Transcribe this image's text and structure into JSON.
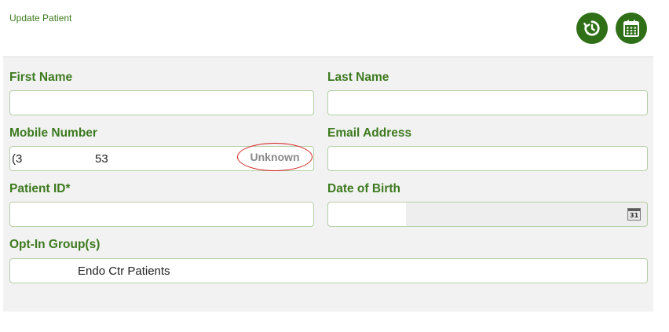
{
  "header": {
    "title": "Update Patient",
    "history_icon": "history-icon",
    "calendar_icon": "calendar-icon"
  },
  "form": {
    "first_name": {
      "label": "First Name",
      "value": ""
    },
    "last_name": {
      "label": "Last Name",
      "value": ""
    },
    "mobile_number": {
      "label": "Mobile Number",
      "value_prefix": "(3",
      "value_suffix": "53",
      "status_badge": "Unknown"
    },
    "email_address": {
      "label": "Email Address",
      "value": ""
    },
    "patient_id": {
      "label": "Patient ID*",
      "value": ""
    },
    "date_of_birth": {
      "label": "Date of Birth",
      "value": "",
      "picker_icon_text": "31"
    },
    "opt_in_groups": {
      "label": "Opt-In Group(s)",
      "value": "Endo Ctr Patients"
    }
  },
  "colors": {
    "accent_green": "#2f6f17",
    "label_green": "#3d7a1f",
    "highlight_red": "#d41f1f"
  }
}
